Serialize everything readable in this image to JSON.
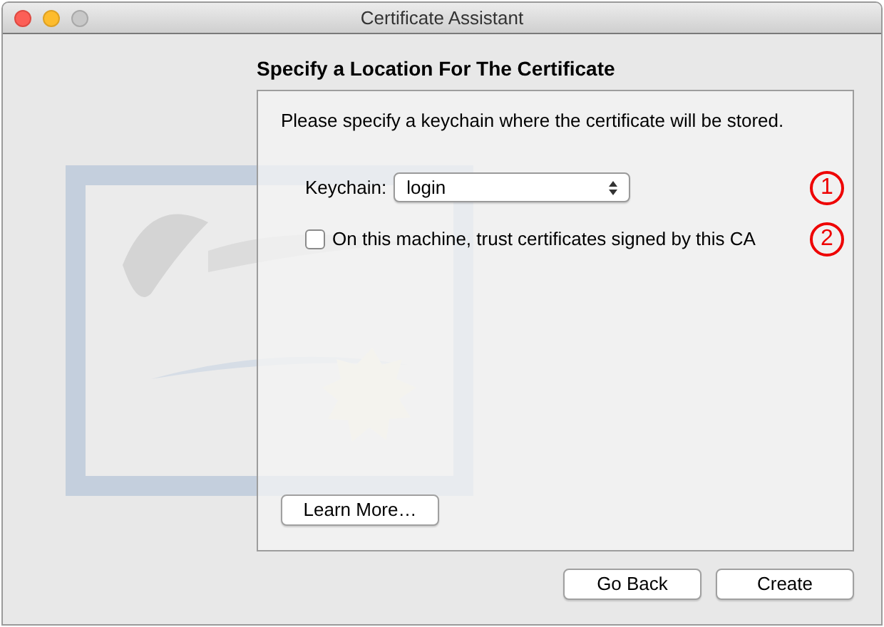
{
  "window": {
    "title": "Certificate Assistant",
    "controls": [
      {
        "kind": "close"
      },
      {
        "kind": "minimize"
      },
      {
        "kind": "zoom"
      }
    ]
  },
  "heading": "Specify a Location For The Certificate",
  "instructions": "Please specify a keychain where the certificate will be stored.",
  "keychain": {
    "label": "Keychain:",
    "value": "login",
    "annotation": "1"
  },
  "trust": {
    "label": "On this machine, trust certificates signed by this CA",
    "checked": false,
    "annotation": "2"
  },
  "learn_more": "Learn More…",
  "buttons": [
    {
      "label": "Go Back"
    },
    {
      "label": "Create"
    }
  ]
}
